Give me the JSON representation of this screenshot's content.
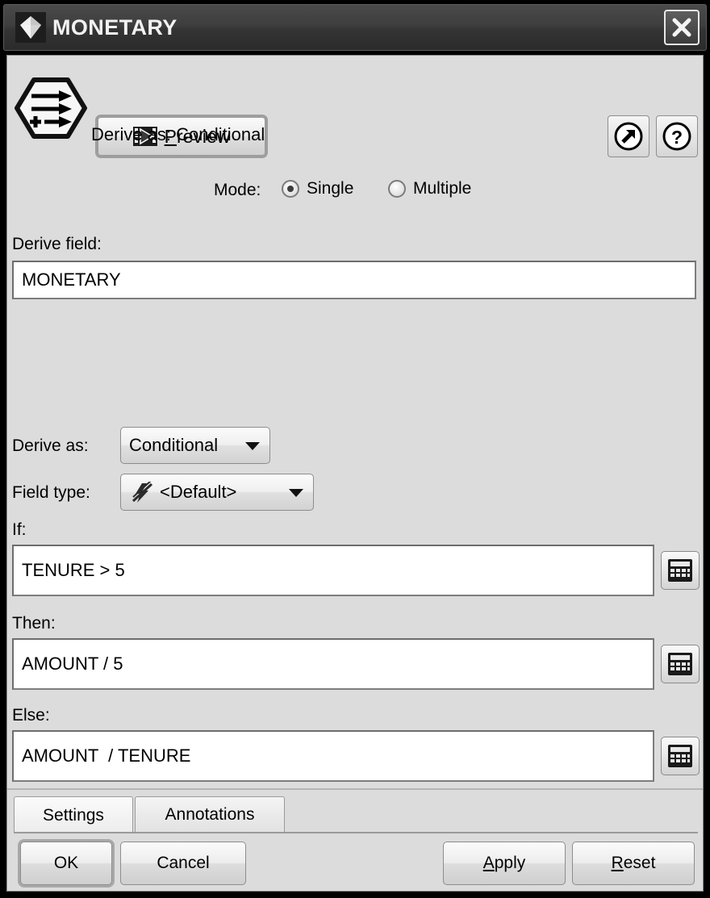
{
  "window": {
    "title": "MONETARY",
    "icon": "gem-icon",
    "close_label": "✕"
  },
  "toolbar": {
    "preview_label_prefix": "",
    "preview_mnemonic": "P",
    "preview_label_rest": "review",
    "preview_icon": "film-play-icon",
    "expand_icon": "arrow-out-icon",
    "help_icon": "question-mark-icon"
  },
  "header": {
    "node_icon": "derive-node-icon",
    "derive_as_summary": "Derive as: Conditional"
  },
  "mode": {
    "label": "Mode:",
    "options": [
      {
        "label": "Single",
        "checked": true
      },
      {
        "label": "Multiple",
        "checked": false
      }
    ]
  },
  "derive_field": {
    "label": "Derive field:",
    "value": "MONETARY",
    "placeholder": ""
  },
  "derive_as": {
    "label": "Derive as:",
    "value": "Conditional"
  },
  "field_type": {
    "label": "Field type:",
    "value": "<Default>",
    "icon": "default-measure-icon"
  },
  "conditions": {
    "if": {
      "label": "If:",
      "value": "TENURE > 5",
      "expression_button_icon": "calculator-icon"
    },
    "then": {
      "label": "Then:",
      "value": "AMOUNT / 5",
      "expression_button_icon": "calculator-icon"
    },
    "else": {
      "label": "Else:",
      "value": "AMOUNT  / TENURE",
      "expression_button_icon": "calculator-icon"
    }
  },
  "tabs": [
    {
      "label": "Settings",
      "active": true
    },
    {
      "label": "Annotations",
      "active": false
    }
  ],
  "buttons": {
    "ok": "OK",
    "cancel": "Cancel",
    "apply_mnemonic": "A",
    "apply_rest": "pply",
    "reset_mnemonic": "R",
    "reset_rest": "eset"
  },
  "colors": {
    "dialog_bg": "#dcdcdc",
    "titlebar": "#3a3a3a",
    "field_bg": "#ffffff",
    "border": "#8a8a8a"
  }
}
